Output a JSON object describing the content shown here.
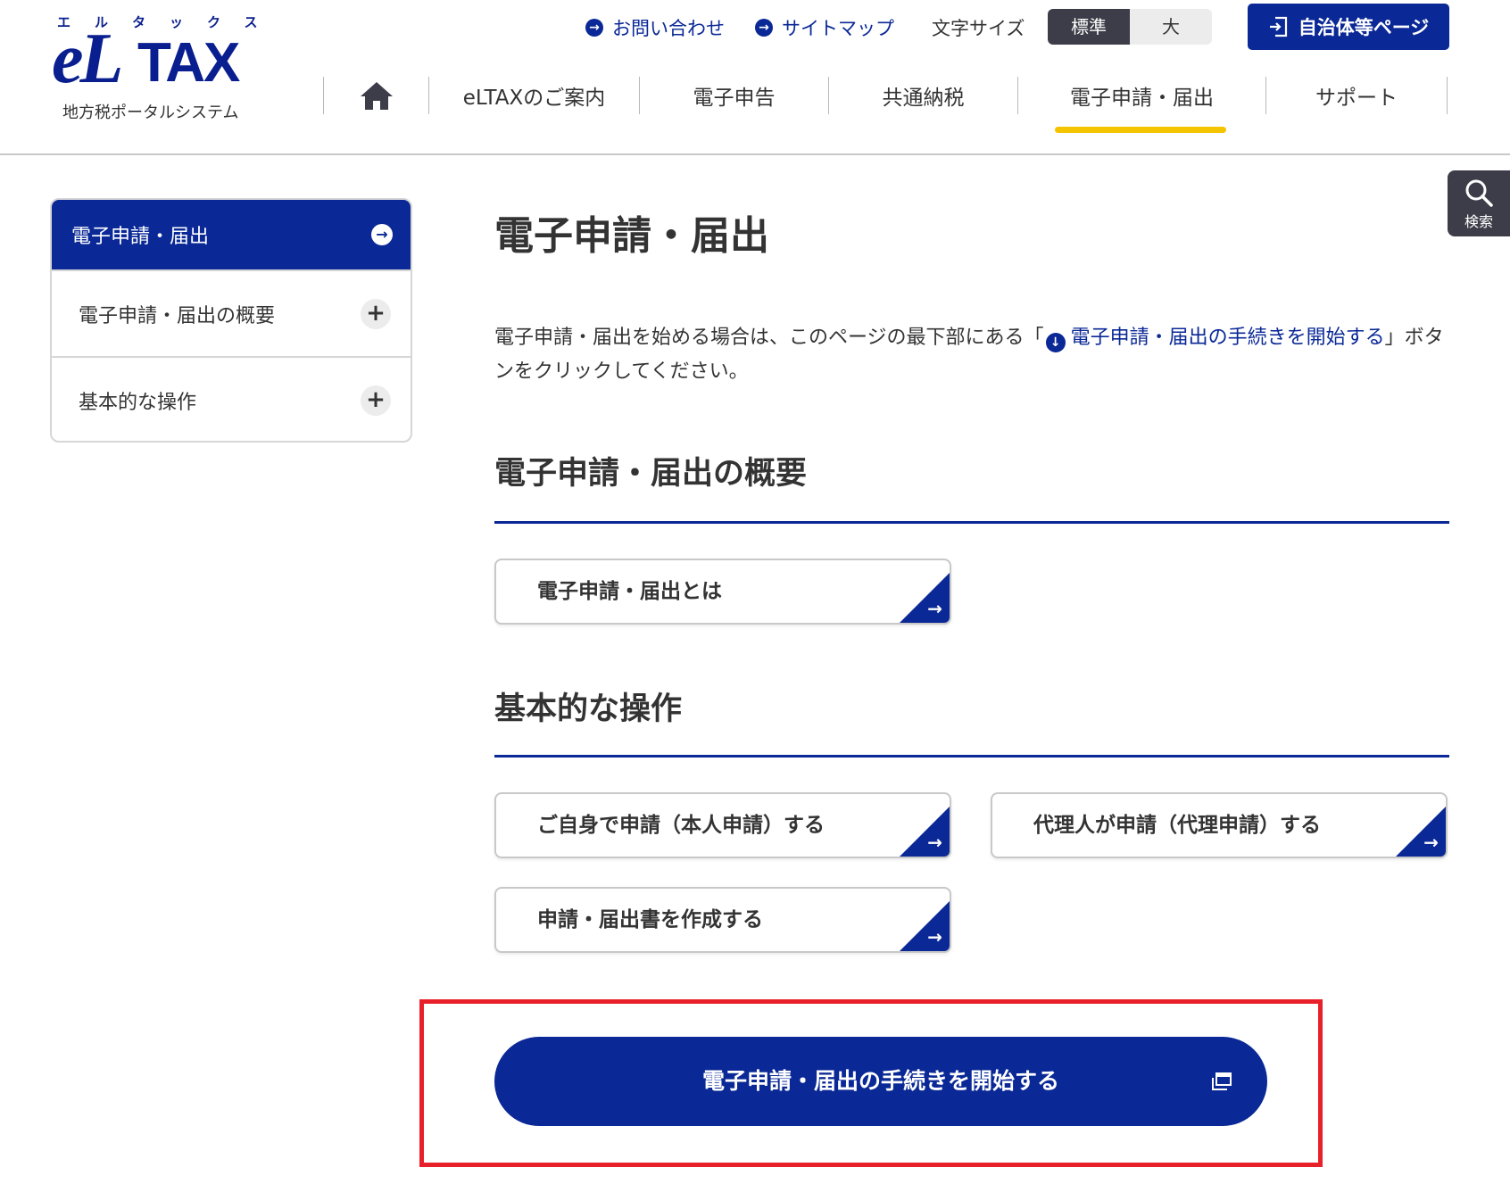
{
  "logo": {
    "kana": "エルタックス",
    "mark": "eL",
    "tax": "TAX",
    "subtitle": "地方税ポータルシステム"
  },
  "utility": {
    "contact": "お問い合わせ",
    "sitemap": "サイトマップ",
    "font_size_label": "文字サイズ",
    "font_size_standard": "標準",
    "font_size_large": "大",
    "municipal_page": "自治体等ページ"
  },
  "nav": {
    "home_icon": "home-icon",
    "items": [
      "eLTAXのご案内",
      "電子申告",
      "共通納税",
      "電子申請・届出",
      "サポート"
    ],
    "active_index": 3
  },
  "search": {
    "label": "検索",
    "icon": "search-icon"
  },
  "sidebar": {
    "header": "電子申請・届出",
    "items": [
      {
        "label": "電子申請・届出の概要"
      },
      {
        "label": "基本的な操作"
      }
    ]
  },
  "main": {
    "title": "電子申請・届出",
    "intro_before": "電子申請・届出を始める場合は、このページの最下部にある「",
    "intro_link": "電子申請・届出の手続きを開始する",
    "intro_after": "」ボタンをクリックしてください。",
    "sections": [
      {
        "title": "電子申請・届出の概要",
        "cards": [
          "電子申請・届出とは"
        ]
      },
      {
        "title": "基本的な操作",
        "cards": [
          "ご自身で申請（本人申請）する",
          "代理人が申請（代理申請）する",
          "申請・届出書を作成する"
        ]
      }
    ],
    "start_button": "電子申請・届出の手続きを開始する"
  },
  "colors": {
    "brand_blue": "#0a2896",
    "active_underline": "#f5c400",
    "highlight_red": "#e8202a",
    "dark_gray": "#3c3d48"
  }
}
